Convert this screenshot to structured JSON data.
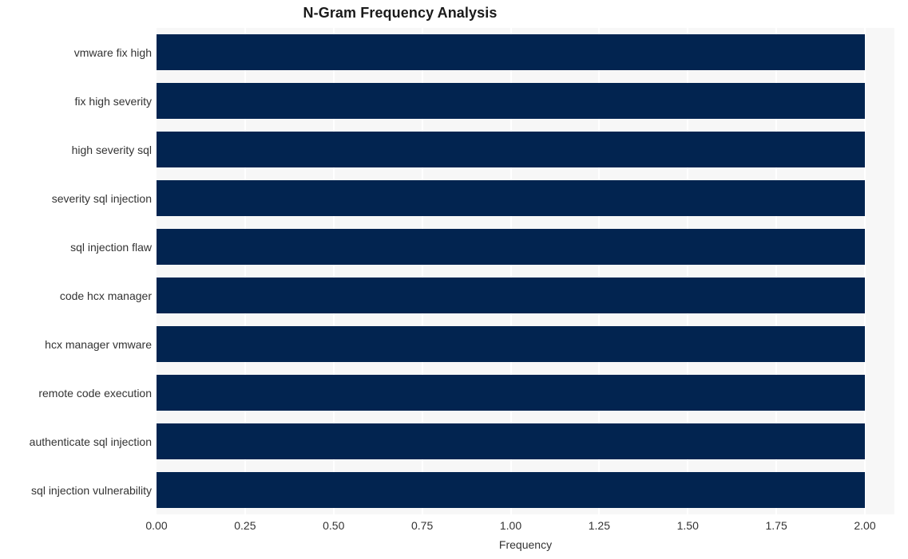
{
  "chart_data": {
    "type": "bar",
    "orientation": "horizontal",
    "title": "N-Gram Frequency Analysis",
    "xlabel": "Frequency",
    "ylabel": "",
    "categories": [
      "vmware fix high",
      "fix high severity",
      "high severity sql",
      "severity sql injection",
      "sql injection flaw",
      "code hcx manager",
      "hcx manager vmware",
      "remote code execution",
      "authenticate sql injection",
      "sql injection vulnerability"
    ],
    "values": [
      2,
      2,
      2,
      2,
      2,
      2,
      2,
      2,
      2,
      2
    ],
    "xlim": [
      0.0,
      2.0
    ],
    "xticks": [
      0.0,
      0.25,
      0.5,
      0.75,
      1.0,
      1.25,
      1.5,
      1.75,
      2.0
    ],
    "xtick_labels": [
      "0.00",
      "0.25",
      "0.50",
      "0.75",
      "1.00",
      "1.25",
      "1.50",
      "1.75",
      "2.00"
    ],
    "grid": true,
    "grid_axis": "x",
    "legend": null,
    "bar_color": "#022450",
    "plot_background": "#f7f7f7",
    "figure_background": "#ffffff",
    "gridline_color": "#ffffff",
    "axis_text_color": "#333333",
    "title_color": "#1a1a1a"
  }
}
